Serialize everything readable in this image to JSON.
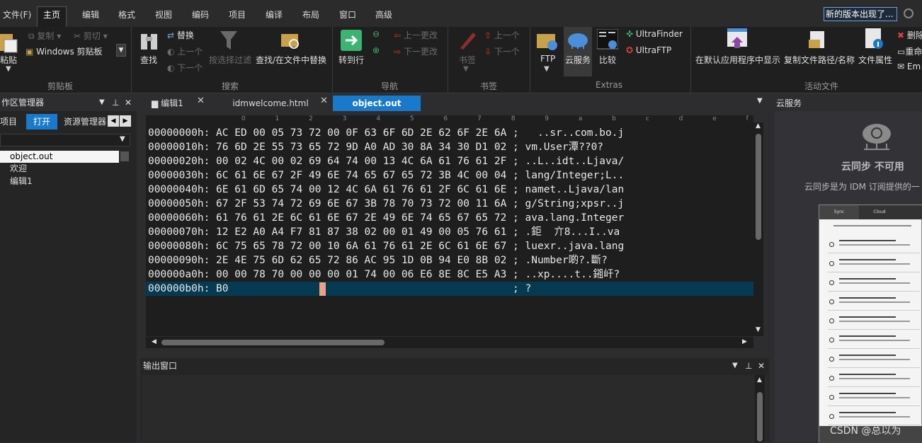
{
  "menu": {
    "items": [
      "文件(F)",
      "主页",
      "编辑",
      "格式",
      "视图",
      "编码",
      "项目",
      "编译",
      "布局",
      "窗口",
      "高级"
    ],
    "update_notice": "新的版本出现了..."
  },
  "ribbon": {
    "clipboard": {
      "paste": "粘贴",
      "copy": "复制",
      "cut": "剪切",
      "windows_clipboard": "Windows 剪贴板",
      "group": "剪贴板"
    },
    "search": {
      "find": "查找",
      "replace": "替换",
      "prev": "上一个",
      "next": "下一个",
      "filter": "按选择过滤",
      "find_in_files": "查找/在文件中替换",
      "group": "搜索"
    },
    "navigation": {
      "goto": "转到行",
      "prev_change": "上一更改",
      "next_change": "下一更改",
      "group": "导航"
    },
    "bookmarks": {
      "bookmark": "书签",
      "prev": "上一个",
      "next": "下一个",
      "group": "书签"
    },
    "extras": {
      "ftp": "FTP",
      "cloud": "云服务",
      "compare": "比较",
      "ultrafinder": "UltraFinder",
      "ultraftp": "UltraFTP",
      "group": "Extras"
    },
    "active_file": {
      "open_default": "在默认应用程序中显示",
      "copy_path": "复制文件路径/名称",
      "properties": "文件属性",
      "delete": "删除",
      "rename": "重命",
      "email": "Em",
      "group": "活动文件"
    }
  },
  "left_panel": {
    "title": "作区管理器",
    "tabs": [
      "项目",
      "打开",
      "资源管理器"
    ],
    "files": [
      "object.out",
      "欢迎",
      "编辑1"
    ]
  },
  "editor": {
    "tabs": [
      "编辑1",
      "idmwelcome.html",
      "object.out"
    ],
    "ruler": "0 1 2 3 4 5 6 7 8 9 a b c d e f",
    "lines": [
      "00000000h: AC ED 00 05 73 72 00 0F 63 6F 6D 2E 62 6F 2E 6A ;   ..sr..com.bo.j",
      "00000010h: 76 6D 2E 55 73 65 72 9D A0 AD 30 8A 34 30 D1 02 ; vm.User潭??0?",
      "00000020h: 00 02 4C 00 02 69 64 74 00 13 4C 6A 61 76 61 2F ; ..L..idt..Ljava/",
      "00000030h: 6C 61 6E 67 2F 49 6E 74 65 67 65 72 3B 4C 00 04 ; lang/Integer;L..",
      "00000040h: 6E 61 6D 65 74 00 12 4C 6A 61 76 61 2F 6C 61 6E ; namet..Ljava/lan",
      "00000050h: 67 2F 53 74 72 69 6E 67 3B 78 70 73 72 00 11 6A ; g/String;xpsr..j",
      "00000060h: 61 76 61 2E 6C 61 6E 67 2E 49 6E 74 65 67 65 72 ; ava.lang.Integer",
      "00000070h: 12 E2 A0 A4 F7 81 87 38 02 00 01 49 00 05 76 61 ; .鉅  亣8...I..va",
      "00000080h: 6C 75 65 78 72 00 10 6A 61 76 61 2E 6C 61 6E 67 ; luexr..java.lang",
      "00000090h: 2E 4E 75 6D 62 65 72 86 AC 95 1D 0B 94 E0 8B 02 ; .Number啲?.斷?",
      "000000a0h: 00 00 78 70 00 00 00 01 74 00 06 E6 8E 8C E5 A3 ; ..xp....t..鎺屽?",
      "000000b0h: B0                                              ; ?"
    ]
  },
  "output": {
    "title": "输出窗口"
  },
  "right_panel": {
    "title": "云服务",
    "cloud_title": "云同步 不可用",
    "cloud_desc": "云同步是为 IDM 订阅提供的一",
    "thumb_tabs": [
      "Sync",
      "Cloud"
    ]
  },
  "watermark": "CSDN @总以为"
}
